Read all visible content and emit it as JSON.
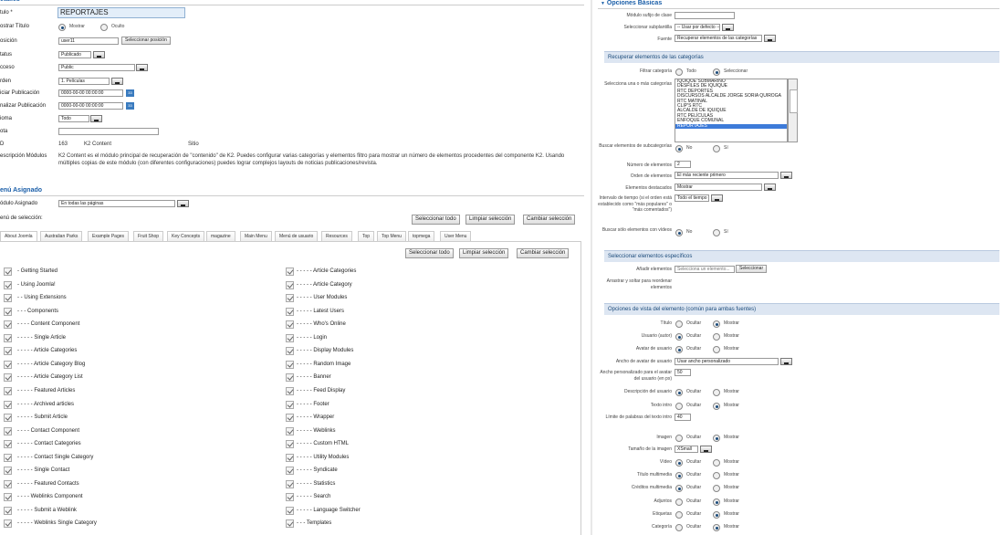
{
  "left": {
    "top_header": "etalles",
    "title_label": "tulo *",
    "title_value": "REPORTAJES",
    "show_title_label": "ostrar Título",
    "show_title_options": [
      "Mostrar",
      "Oculto"
    ],
    "position_label": "osición",
    "position_value": "user11",
    "position_button": "Seleccionar posición",
    "status_label": "tatus",
    "status_value": "Publicado",
    "access_label": "cceso",
    "access_value": "Public",
    "order_label": "rden",
    "order_value": "1. Películas",
    "start_pub_label": "iciar Publicación",
    "start_pub_value": "0000-00-00 00:00:00",
    "end_pub_label": "nalizar Publicación",
    "end_pub_value": "0000-00-00 00:00:00",
    "calendar_glyph": "33",
    "language_label": "ioma",
    "language_value": "Todo",
    "note_label": "ota",
    "note_value": "",
    "id_label": "D",
    "id_value": "163",
    "module_type": "K2 Content",
    "site_label": "Sitio",
    "description_label": "escripción Módulos",
    "description_text": "K2 Content es el módulo principal de recuperación de \"contenido\" de K2. Puedes configurar varias categorías y elementos filtro para mostrar un número de elementos procedentes del componente K2. Usando múltiples copias de este módulo (con diferentes configuraciones) puedes lograr complejos layouts de noticias publicaciones/revista.",
    "menu_section": "enú Asignado",
    "module_assigned_label": "ódulo Asignado",
    "module_assigned_value": "En todas las páginas",
    "menu_selection_label": "enú de selección:",
    "buttons": {
      "select_all": "Seleccionar todo",
      "clear": "Limpiar selección",
      "toggle": "Cambiar selección"
    },
    "tabs": [
      "About Joomla",
      "Australian Parks",
      "Example Pages",
      "Fruit Shop",
      "Key Concepts",
      "magazine",
      "Main Menu",
      "Menú de usuario",
      "Resources",
      "Top",
      "Top Menu",
      "topmega",
      "User Menu"
    ],
    "menu_col1": [
      "- Getting Started",
      "- Using Joomla!",
      "- - Using Extensions",
      "- - - Components",
      "- - - - Content Component",
      "- - - - - Single Article",
      "- - - - - Article Categories",
      "- - - - - Article Category Blog",
      "- - - - - Article Category List",
      "- - - - - Featured Articles",
      "- - - - - Archived articles",
      "- - - - - Submit Article",
      "- - - - Contact Component",
      "- - - - - Contact Categories",
      "- - - - - Contact Single Category",
      "- - - - - Single Contact",
      "- - - - - Featured Contacts",
      "- - - - Weblinks Component",
      "- - - - - Submit a Weblink",
      "- - - - - Weblinks Single Category"
    ],
    "menu_col2": [
      "- - - - - Article Categories",
      "- - - - - Article Category",
      "- - - - - User Modules",
      "- - - - - Latest Users",
      "- - - - - Who's Online",
      "- - - - - Login",
      "- - - - - Display Modules",
      "- - - - - Random Image",
      "- - - - - Banner",
      "- - - - - Feed Display",
      "- - - - - Footer",
      "- - - - - Wrapper",
      "- - - - - Weblinks",
      "- - - - - Custom HTML",
      "- - - - - Utility Modules",
      "- - - - - Syndicate",
      "- - - - - Statistics",
      "- - - - - Search",
      "- - - - - Language Switcher",
      "- - - Templates"
    ]
  },
  "right": {
    "header": "Opciones Básicas",
    "suffix_label": "Módulo sufijo de clase",
    "subtemplate_label": "Seleccionar subplantilla",
    "subtemplate_value": "-- Usar por defecto --",
    "source_label": "Fuente",
    "source_value": "Recuperar elementos de las categorías",
    "band_categories": "Recuperar elementos de las categorías",
    "filter_label": "Filtrar categoría",
    "filter_options": [
      "Todo",
      "Seleccionar"
    ],
    "select_cats_label": "Selecciona una o más categorías",
    "categories": [
      "IQUIQUE SUBMARINO",
      "DESFILES DE IQUIQUE",
      "RTC DEPORTES",
      "DISCURSOS ALCALDE JORGE SORIA QUIROGA",
      "RTC MATINAL",
      "CLIP'S RTC",
      "ALCALDE DE IQUIQUE",
      "RTC PELÍCULAS",
      "ENFOQUE COMUNAL",
      "REPORTAJES"
    ],
    "subcat_label": "Buscar elementos de subcategorías",
    "yes_no": [
      "No",
      "Sí"
    ],
    "num_items_label": "Número de elementos",
    "num_items_value": "2",
    "order_label": "Orden de elementos",
    "order_value": "El más reciente primero",
    "featured_label": "Elementos destacados",
    "featured_value": "Mostrar",
    "interval_label": "Intervalo de tiempo (si el orden está establecido como \"más populares\" o \"más comentados\")",
    "interval_value": "Todo el tiempo",
    "videos_label": "Buscar sólo elementos con vídeos",
    "band_specific": "Seleccionar elementos específicos",
    "add_items_label": "Añadir elementos",
    "add_items_placeholder": "Selecciona un elemento...",
    "add_items_button": "Seleccionar",
    "drag_label": "Arrastrar y soltar para reordenar elementos",
    "band_view": "Opciones de vista del elemento (común para ambas fuentes)",
    "hide_show": [
      "Ocultar",
      "Mostrar"
    ],
    "title_label": "Título",
    "user_label": "Usuario (autor)",
    "avatar_label": "Avatar de usuario",
    "avatar_width_label": "Ancho de avatar de usuario",
    "avatar_width_value": "Usar ancho personalizado",
    "custom_width_label": "Ancho personalizado para el avatar del usuario (en px)",
    "custom_width_value": "50",
    "user_desc_label": "Descripción del usuario",
    "intro_label": "Texto intro",
    "word_limit_label": "Límite de palabras del texto intro",
    "word_limit_value": "40",
    "image_label": "Imagen",
    "image_size_label": "Tamaño de la imagen",
    "image_size_value": "XSmall",
    "video_label": "Vídeo",
    "media_title_label": "Título multimedia",
    "media_credits_label": "Créditos multimedia",
    "attachments_label": "Adjuntos",
    "tags_label": "Etiquetas",
    "category_label": "Categoría"
  }
}
